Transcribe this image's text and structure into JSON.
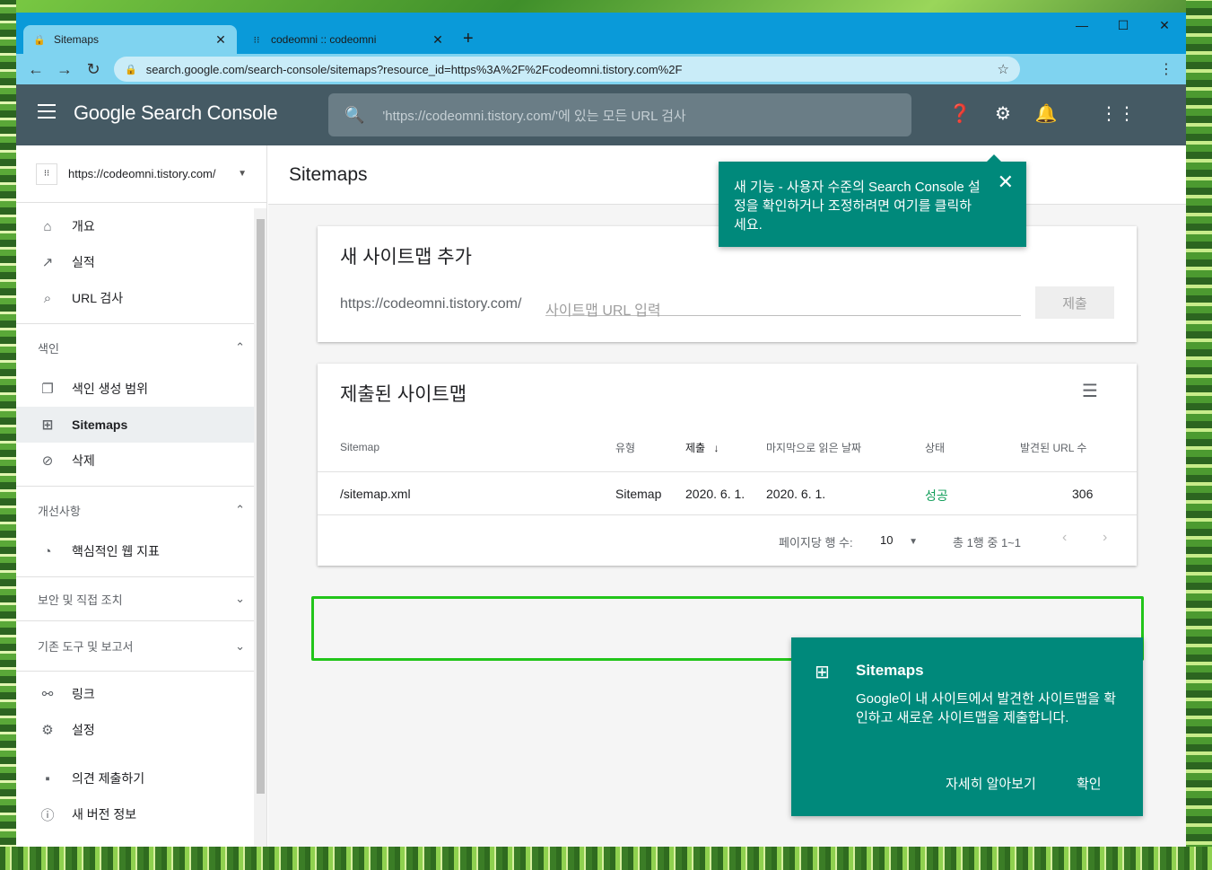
{
  "browser": {
    "tabs": [
      {
        "title": "Sitemaps",
        "close": "✕"
      },
      {
        "title": "codeomni :: codeomni",
        "close": "✕"
      }
    ],
    "new_tab": "+",
    "window_controls": {
      "minimize": "—",
      "maximize": "☐",
      "close": "✕"
    },
    "url": "search.google.com/search-console/sitemaps?resource_id=https%3A%2F%2Fcodeomni.tistory.com%2F"
  },
  "header": {
    "logo": "Google Search Console",
    "search_placeholder": "'https://codeomni.tistory.com/'에 있는 모든 URL 검사"
  },
  "sidebar": {
    "property": "https://codeomni.tistory.com/",
    "top_items": [
      {
        "label": "개요",
        "icon": "home-icon"
      },
      {
        "label": "실적",
        "icon": "trending-up-icon"
      },
      {
        "label": "URL 검사",
        "icon": "search-icon"
      }
    ],
    "index_section": "색인",
    "index_items": [
      {
        "label": "색인 생성 범위",
        "icon": "copy-icon"
      },
      {
        "label": "Sitemaps",
        "icon": "sitemap-icon"
      },
      {
        "label": "삭제",
        "icon": "eye-off-icon"
      }
    ],
    "enhance_section": "개선사항",
    "enhance_items": [
      {
        "label": "핵심적인 웹 지표",
        "icon": "speed-icon"
      }
    ],
    "security_section": "보안 및 직접 조치",
    "legacy_section": "기존 도구 및 보고서",
    "bottom_items": [
      {
        "label": "링크",
        "icon": "links-icon"
      },
      {
        "label": "설정",
        "icon": "gear-icon"
      }
    ],
    "footer_items": [
      {
        "label": "의견 제출하기",
        "icon": "feedback-icon"
      },
      {
        "label": "새 버전 정보",
        "icon": "info-icon"
      }
    ]
  },
  "main": {
    "page_title": "Sitemaps",
    "add_card": {
      "title": "새 사이트맵 추가",
      "prefix": "https://codeomni.tistory.com/",
      "placeholder": "사이트맵 URL 입력",
      "submit": "제출"
    },
    "submitted_card": {
      "title": "제출된 사이트맵",
      "columns": [
        "Sitemap",
        "유형",
        "제출",
        "마지막으로 읽은 날짜",
        "상태",
        "발견된 URL 수"
      ],
      "rows": [
        {
          "sitemap": "/sitemap.xml",
          "type": "Sitemap",
          "submitted": "2020. 6. 1.",
          "last_read": "2020. 6. 1.",
          "status": "성공",
          "urls": "306"
        }
      ],
      "rows_per_page_label": "페이지당 행 수:",
      "rows_per_page": "10",
      "range": "총 1행 중 1~1"
    }
  },
  "tooltip": {
    "text": "새 기능 - 사용자 수준의 Search Console 설정을 확인하거나 조정하려면 여기를 클릭하세요."
  },
  "info_card": {
    "title": "Sitemaps",
    "description": "Google이 내 사이트에서 발견한 사이트맵을 확인하고 새로운 사이트맵을 제출합니다.",
    "learn_more": "자세히 알아보기",
    "ok": "확인"
  },
  "colors": {
    "header": "#455a64",
    "teal": "#00897b",
    "success": "#0f9d58",
    "tab_bar": "#0a9ad9"
  }
}
